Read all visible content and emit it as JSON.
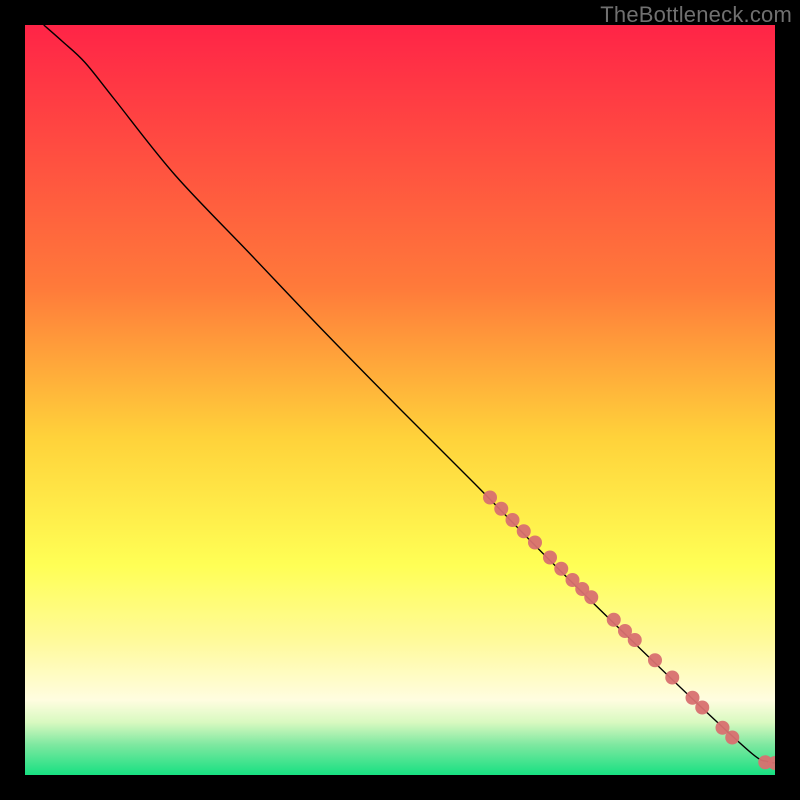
{
  "watermark": "TheBottleneck.com",
  "chart_data": {
    "type": "line",
    "title": "",
    "xlabel": "",
    "ylabel": "",
    "xlim": [
      0,
      100
    ],
    "ylim": [
      0,
      100
    ],
    "grid": false,
    "axes_visible": false,
    "legend": null,
    "gradient_background": {
      "direction": "top-to-bottom",
      "stops": [
        {
          "pos": 0.0,
          "color": "#ff2447"
        },
        {
          "pos": 0.35,
          "color": "#ff7a3a"
        },
        {
          "pos": 0.55,
          "color": "#ffd23a"
        },
        {
          "pos": 0.72,
          "color": "#ffff55"
        },
        {
          "pos": 0.82,
          "color": "#fffa9a"
        },
        {
          "pos": 0.9,
          "color": "#fffde0"
        },
        {
          "pos": 0.93,
          "color": "#d8f9c0"
        },
        {
          "pos": 0.96,
          "color": "#7de8a0"
        },
        {
          "pos": 1.0,
          "color": "#17e082"
        }
      ]
    },
    "series": [
      {
        "name": "curve",
        "color": "#000000",
        "stroke_width": 1.4,
        "values": [
          {
            "x": 2.5,
            "y": 100.0
          },
          {
            "x": 5.0,
            "y": 97.8
          },
          {
            "x": 8.0,
            "y": 95.0
          },
          {
            "x": 12.0,
            "y": 90.0
          },
          {
            "x": 20.0,
            "y": 80.0
          },
          {
            "x": 30.0,
            "y": 69.5
          },
          {
            "x": 40.0,
            "y": 59.0
          },
          {
            "x": 50.0,
            "y": 48.8
          },
          {
            "x": 60.0,
            "y": 38.8
          },
          {
            "x": 70.0,
            "y": 28.6
          },
          {
            "x": 80.0,
            "y": 18.8
          },
          {
            "x": 90.0,
            "y": 9.2
          },
          {
            "x": 97.0,
            "y": 2.8
          },
          {
            "x": 99.0,
            "y": 1.8
          },
          {
            "x": 100.0,
            "y": 1.6
          }
        ]
      }
    ],
    "scatter_points": {
      "color": "#d87070",
      "radius": 7,
      "opacity": 0.95,
      "values": [
        {
          "x": 62.0,
          "y": 37.0
        },
        {
          "x": 63.5,
          "y": 35.5
        },
        {
          "x": 65.0,
          "y": 34.0
        },
        {
          "x": 66.5,
          "y": 32.5
        },
        {
          "x": 68.0,
          "y": 31.0
        },
        {
          "x": 70.0,
          "y": 29.0
        },
        {
          "x": 71.5,
          "y": 27.5
        },
        {
          "x": 73.0,
          "y": 26.0
        },
        {
          "x": 74.3,
          "y": 24.8
        },
        {
          "x": 75.5,
          "y": 23.7
        },
        {
          "x": 78.5,
          "y": 20.7
        },
        {
          "x": 80.0,
          "y": 19.2
        },
        {
          "x": 81.3,
          "y": 18.0
        },
        {
          "x": 84.0,
          "y": 15.3
        },
        {
          "x": 86.3,
          "y": 13.0
        },
        {
          "x": 89.0,
          "y": 10.3
        },
        {
          "x": 90.3,
          "y": 9.0
        },
        {
          "x": 93.0,
          "y": 6.3
        },
        {
          "x": 94.3,
          "y": 5.0
        },
        {
          "x": 98.7,
          "y": 1.7
        },
        {
          "x": 100.0,
          "y": 1.6
        }
      ]
    }
  }
}
